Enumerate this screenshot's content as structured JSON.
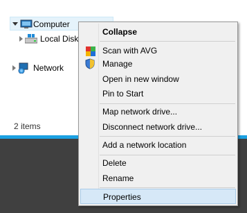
{
  "explorer": {
    "tree": [
      {
        "label": "Computer",
        "state": "expanded",
        "selected": true
      },
      {
        "label": "Local Disk",
        "state": "collapsed"
      },
      {
        "label": "Network",
        "state": "collapsed"
      }
    ],
    "status_text": "2 items"
  },
  "context_menu": {
    "items": [
      {
        "label": "Collapse",
        "bold": true,
        "icon": ""
      },
      {
        "label": "Scan with AVG",
        "icon": "avg-icon"
      },
      {
        "label": "Manage",
        "icon": "uac-shield-icon"
      },
      {
        "label": "Open in new window",
        "icon": ""
      },
      {
        "label": "Pin to Start",
        "icon": ""
      },
      {
        "label": "Map network drive...",
        "icon": ""
      },
      {
        "label": "Disconnect network drive...",
        "icon": ""
      },
      {
        "label": "Add a network location",
        "icon": ""
      },
      {
        "label": "Delete",
        "icon": ""
      },
      {
        "label": "Rename",
        "icon": ""
      },
      {
        "label": "Properties",
        "icon": "",
        "highlighted": true
      }
    ]
  },
  "colors": {
    "accent": "#1ba1e2",
    "menu_bg": "#f0f0f0",
    "highlight": "#d6e8f7",
    "taskbar": "#404040"
  }
}
